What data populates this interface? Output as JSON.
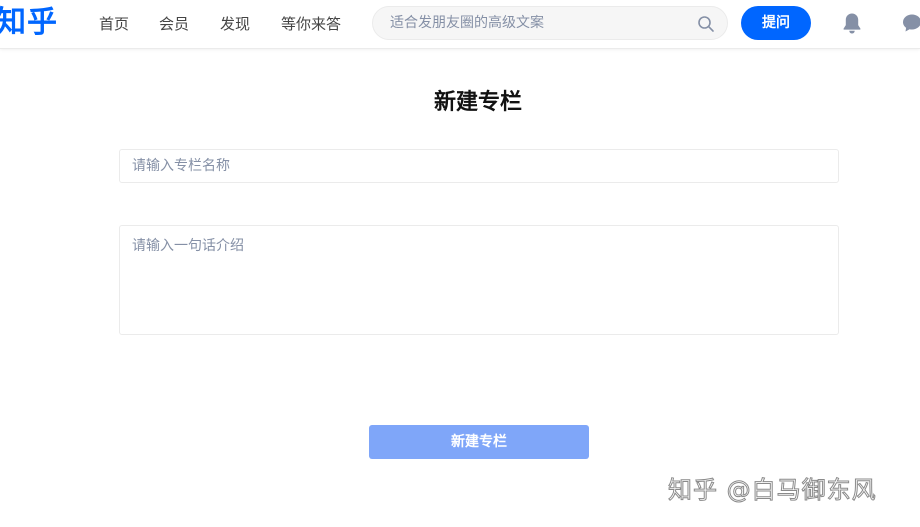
{
  "header": {
    "logo": "知乎",
    "nav": [
      "首页",
      "会员",
      "发现",
      "等你来答"
    ],
    "search": {
      "placeholder": "适合发朋友圈的高级文案",
      "icon": "search-icon"
    },
    "ask_label": "提问",
    "icons": [
      "bell-icon",
      "chat-icon"
    ]
  },
  "form": {
    "title": "新建专栏",
    "name_placeholder": "请输入专栏名称",
    "name_value": "",
    "intro_placeholder": "请输入一句话介绍",
    "intro_value": "",
    "submit_label": "新建专栏",
    "submit_disabled": true
  },
  "watermark": "知乎 @白马御东风",
  "colors": {
    "brand": "#0066ff",
    "disabled_button": "#7fa6f9",
    "placeholder": "#8590a6",
    "border": "#ebebeb",
    "text": "#121212",
    "nav_text": "#444444"
  }
}
